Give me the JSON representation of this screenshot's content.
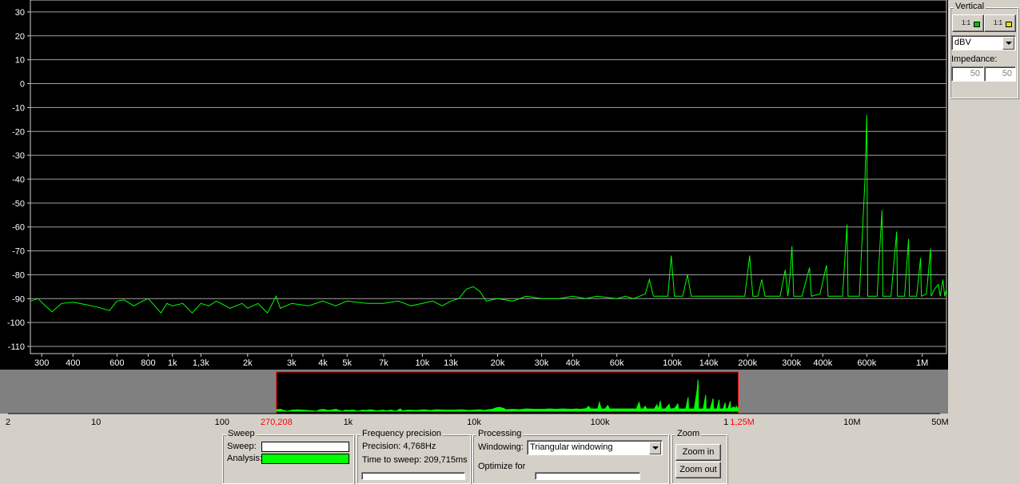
{
  "chart_data": [
    {
      "type": "line",
      "name": "main-spectrum",
      "x_scale": "log",
      "xlim": [
        270.208,
        1250000
      ],
      "ylim": [
        -113,
        35
      ],
      "y_ticks": [
        30,
        20,
        10,
        0,
        -10,
        -20,
        -30,
        -40,
        -50,
        -60,
        -70,
        -80,
        -90,
        -100,
        -110
      ],
      "x_ticks": [
        {
          "v": 300,
          "label": "300"
        },
        {
          "v": 400,
          "label": "400"
        },
        {
          "v": 600,
          "label": "600"
        },
        {
          "v": 800,
          "label": "800"
        },
        {
          "v": 1000,
          "label": "1k"
        },
        {
          "v": 1300,
          "label": "1,3k"
        },
        {
          "v": 2000,
          "label": "2k"
        },
        {
          "v": 3000,
          "label": "3k"
        },
        {
          "v": 4000,
          "label": "4k"
        },
        {
          "v": 5000,
          "label": "5k"
        },
        {
          "v": 7000,
          "label": "7k"
        },
        {
          "v": 10000,
          "label": "10k"
        },
        {
          "v": 13000,
          "label": "13k"
        },
        {
          "v": 20000,
          "label": "20k"
        },
        {
          "v": 30000,
          "label": "30k"
        },
        {
          "v": 40000,
          "label": "40k"
        },
        {
          "v": 60000,
          "label": "60k"
        },
        {
          "v": 100000,
          "label": "100k"
        },
        {
          "v": 140000,
          "label": "140k"
        },
        {
          "v": 200000,
          "label": "200k"
        },
        {
          "v": 300000,
          "label": "300k"
        },
        {
          "v": 400000,
          "label": "400k"
        },
        {
          "v": 600000,
          "label": "600k"
        },
        {
          "v": 1000000,
          "label": "1M"
        }
      ],
      "grid": true,
      "series": [
        {
          "color": "#00ff00",
          "points": [
            [
              270.208,
              -91
            ],
            [
              290,
              -90
            ],
            [
              310,
              -93
            ],
            [
              330,
              -95.5
            ],
            [
              360,
              -92
            ],
            [
              400,
              -91.5
            ],
            [
              450,
              -92.5
            ],
            [
              500,
              -93.5
            ],
            [
              560,
              -95
            ],
            [
              600,
              -91
            ],
            [
              640,
              -90.5
            ],
            [
              700,
              -93
            ],
            [
              760,
              -91
            ],
            [
              800,
              -90
            ],
            [
              850,
              -93
            ],
            [
              900,
              -96
            ],
            [
              950,
              -92
            ],
            [
              1000,
              -93
            ],
            [
              1100,
              -92
            ],
            [
              1200,
              -96
            ],
            [
              1300,
              -92
            ],
            [
              1400,
              -93
            ],
            [
              1500,
              -91
            ],
            [
              1700,
              -94
            ],
            [
              1900,
              -92
            ],
            [
              2000,
              -94
            ],
            [
              2200,
              -92
            ],
            [
              2400,
              -96
            ],
            [
              2600,
              -89
            ],
            [
              2700,
              -94
            ],
            [
              3000,
              -92
            ],
            [
              3500,
              -93
            ],
            [
              4000,
              -91
            ],
            [
              4500,
              -93
            ],
            [
              5000,
              -91
            ],
            [
              6000,
              -92
            ],
            [
              7000,
              -92
            ],
            [
              8000,
              -91
            ],
            [
              9000,
              -93
            ],
            [
              10000,
              -92
            ],
            [
              11000,
              -91
            ],
            [
              12000,
              -93
            ],
            [
              13000,
              -91
            ],
            [
              14000,
              -90
            ],
            [
              15000,
              -86
            ],
            [
              16000,
              -85
            ],
            [
              17000,
              -87
            ],
            [
              18000,
              -91
            ],
            [
              20000,
              -90
            ],
            [
              23000,
              -91
            ],
            [
              26000,
              -89
            ],
            [
              30000,
              -90
            ],
            [
              35000,
              -90
            ],
            [
              40000,
              -89
            ],
            [
              45000,
              -90
            ],
            [
              50000,
              -89
            ],
            [
              60000,
              -90
            ],
            [
              65000,
              -89
            ],
            [
              70000,
              -90
            ],
            [
              78000,
              -88
            ],
            [
              81000,
              -82
            ],
            [
              84000,
              -89
            ],
            [
              90000,
              -89
            ],
            [
              96000,
              -89
            ],
            [
              99000,
              -72
            ],
            [
              102000,
              -89
            ],
            [
              110000,
              -89
            ],
            [
              115000,
              -80
            ],
            [
              119000,
              -89
            ],
            [
              130000,
              -89
            ],
            [
              150000,
              -89
            ],
            [
              170000,
              -89
            ],
            [
              195000,
              -89
            ],
            [
              204000,
              -72
            ],
            [
              210000,
              -89
            ],
            [
              220000,
              -89
            ],
            [
              228000,
              -82
            ],
            [
              235000,
              -89
            ],
            [
              270000,
              -89
            ],
            [
              283000,
              -78
            ],
            [
              290000,
              -89
            ],
            [
              296000,
              -80
            ],
            [
              301000,
              -68
            ],
            [
              306000,
              -89
            ],
            [
              330000,
              -89
            ],
            [
              354000,
              -77
            ],
            [
              360000,
              -89
            ],
            [
              390000,
              -88
            ],
            [
              414000,
              -76
            ],
            [
              420000,
              -89
            ],
            [
              480000,
              -89
            ],
            [
              500000,
              -59
            ],
            [
              505000,
              -89
            ],
            [
              560000,
              -89
            ],
            [
              590000,
              -40
            ],
            [
              600000,
              -13
            ],
            [
              605000,
              -89
            ],
            [
              660000,
              -89
            ],
            [
              690000,
              -53
            ],
            [
              696000,
              -89
            ],
            [
              750000,
              -89
            ],
            [
              790000,
              -62
            ],
            [
              796000,
              -89
            ],
            [
              850000,
              -89
            ],
            [
              882000,
              -65
            ],
            [
              888000,
              -89
            ],
            [
              950000,
              -89
            ],
            [
              985000,
              -73
            ],
            [
              992000,
              -89
            ],
            [
              1040000,
              -88
            ],
            [
              1080000,
              -69
            ],
            [
              1086000,
              -89
            ],
            [
              1120000,
              -86
            ],
            [
              1160000,
              -84
            ],
            [
              1180000,
              -89
            ],
            [
              1210000,
              -82
            ],
            [
              1230000,
              -89
            ],
            [
              1250000,
              -86
            ]
          ]
        }
      ]
    },
    {
      "type": "area",
      "name": "overview-spectrum",
      "x_scale": "log",
      "xlim": [
        2,
        50000000
      ],
      "x_ticks": [
        {
          "v": 2,
          "label": "2"
        },
        {
          "v": 10,
          "label": "10"
        },
        {
          "v": 100,
          "label": "100"
        },
        {
          "v": 1000,
          "label": "1k"
        },
        {
          "v": 10000,
          "label": "10k"
        },
        {
          "v": 100000,
          "label": "100k"
        },
        {
          "v": 1000000,
          "label": "1"
        },
        {
          "v": 10000000,
          "label": "10M"
        },
        {
          "v": 50000000,
          "label": "50M"
        }
      ],
      "selection": {
        "start": 270.208,
        "end": 1250000,
        "start_label": "270,208",
        "end_label": "1,25M"
      },
      "series": [
        {
          "color": "#00ff00"
        }
      ]
    }
  ],
  "vertical": {
    "title": "Vertical",
    "ch1_label": "1:1",
    "ch1_color": "#00c000",
    "ch2_label": "1:1",
    "ch2_color": "#e0e000",
    "unit": "dBV",
    "impedance_label": "Impedance:",
    "impedance_ch1": "50",
    "impedance_ch2": "50"
  },
  "sweep": {
    "title": "Sweep",
    "sweep_label": "Sweep:",
    "analysis_label": "Analysis:",
    "analysis_color": "#00ff00"
  },
  "precision": {
    "title": "Frequency precision",
    "precision_text": "Precision: 4,768Hz",
    "time_text": "Time to sweep: 209,715ms"
  },
  "processing": {
    "title": "Processing",
    "windowing_label": "Windowing:",
    "windowing_value": "Triangular windowing",
    "optimize_label": "Optimize for"
  },
  "zoom": {
    "title": "Zoom",
    "zoom_in": "Zoom in",
    "zoom_out": "Zoom out"
  }
}
